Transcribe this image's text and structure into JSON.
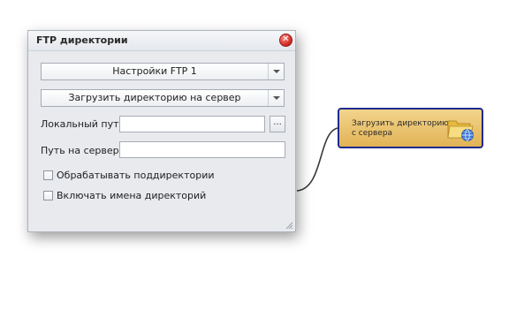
{
  "dialog": {
    "title": "FTP директории",
    "close_glyph": "✕",
    "settings_combo": {
      "value": "Настройки FTP 1"
    },
    "action_combo": {
      "value": "Загрузить директорию на сервер"
    },
    "local_path": {
      "label": "Локальный путь",
      "value": "",
      "browse_label": "..."
    },
    "server_path": {
      "label": "Путь на сервере",
      "value": ""
    },
    "recursive_checkbox": {
      "label": "Обрабатывать поддиректории",
      "checked": false
    },
    "include_names_checkbox": {
      "label": "Включать имена директорий",
      "checked": false
    }
  },
  "node": {
    "label": "Загрузить директорию с сервера",
    "icon": "folder-globe-icon"
  },
  "colors": {
    "node_fill": "#e8c26e",
    "node_border": "#1f2a8c",
    "close_red": "#d8302a",
    "connector": "#3a3a3a"
  }
}
